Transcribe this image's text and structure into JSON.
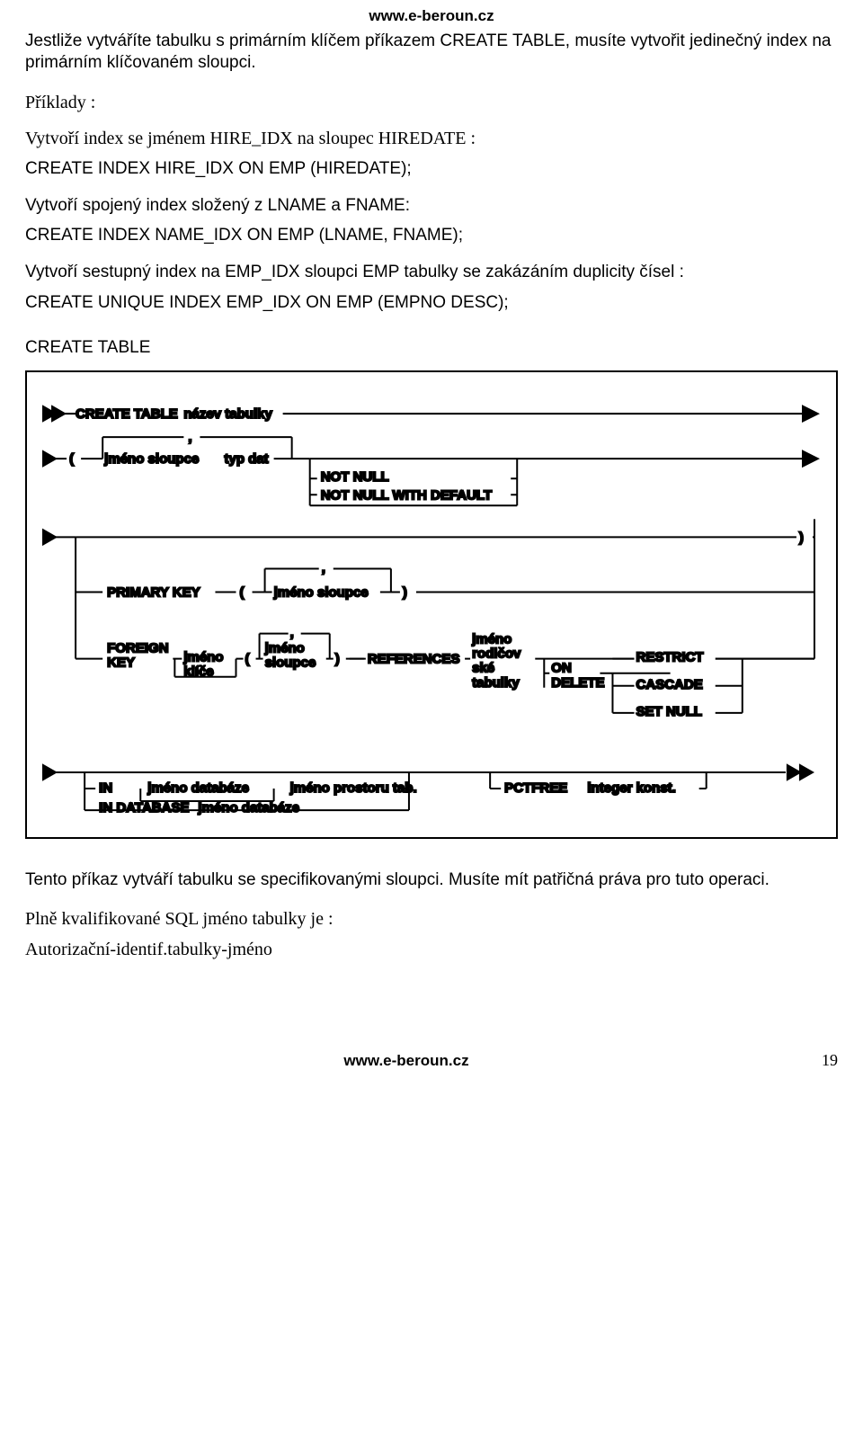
{
  "header": {
    "url": "www.e-beroun.cz"
  },
  "p1": "Jestliže vytváříte tabulku s primárním klíčem příkazem CREATE TABLE, musíte vytvořit jedinečný index na primárním klíčovaném sloupci.",
  "examples_label": "Příklady :",
  "ex1_intro": "Vytvoří index se jménem HIRE_IDX na sloupec HIREDATE :",
  "ex1_sql": "CREATE INDEX HIRE_IDX ON EMP (HIREDATE);",
  "ex2_intro": "Vytvoří spojený index složený z LNAME a FNAME:",
  "ex2_sql": "CREATE INDEX NAME_IDX ON EMP (LNAME, FNAME);",
  "ex3_intro": "Vytvoří sestupný index na EMP_IDX sloupci EMP tabulky se zakázáním duplicity čísel :",
  "ex3_sql": "CREATE UNIQUE INDEX EMP_IDX ON EMP (EMPNO DESC);",
  "heading_create_table": "CREATE TABLE",
  "diagram": {
    "create_table": "CREATE TABLE",
    "nazev_tabulky": "název tabulky",
    "lparen": "(",
    "jmeno_sloupce": "jméno sloupce",
    "typ_dat": "typ dat",
    "not_null": "NOT NULL",
    "not_null_default": "NOT NULL WITH DEFAULT",
    "rparen": ")",
    "primary_key": "PRIMARY KEY",
    "foreign_key": "FOREIGN\nKEY",
    "jmeno_klice": "jméno\nklíče",
    "references": "REFERENCES",
    "jmeno_rodicovske_tabulky": "jméno\nrodičov\nské\ntabulky",
    "on_delete": "ON\nDELETE",
    "restrict": "RESTRICT",
    "cascade": "CASCADE",
    "set_null": "SET NULL",
    "in": "IN",
    "jmeno_databaze": "jméno databáze",
    "in_database": "IN DATABASE",
    "jmeno_prostoru_tab": "jméno prostoru tab.",
    "pctfree": "PCTFREE",
    "integer_konst": "integer konst.",
    "comma": ","
  },
  "p_after": "Tento příkaz vytváří tabulku se specifikovanými sloupci. Musíte mít patřičná práva pro tuto operaci.",
  "p_qual": "Plně kvalifikované SQL jméno tabulky je :",
  "p_ident": "Autorizační-identif.tabulky-jméno",
  "footer": {
    "url": "www.e-beroun.cz",
    "page": "19"
  }
}
